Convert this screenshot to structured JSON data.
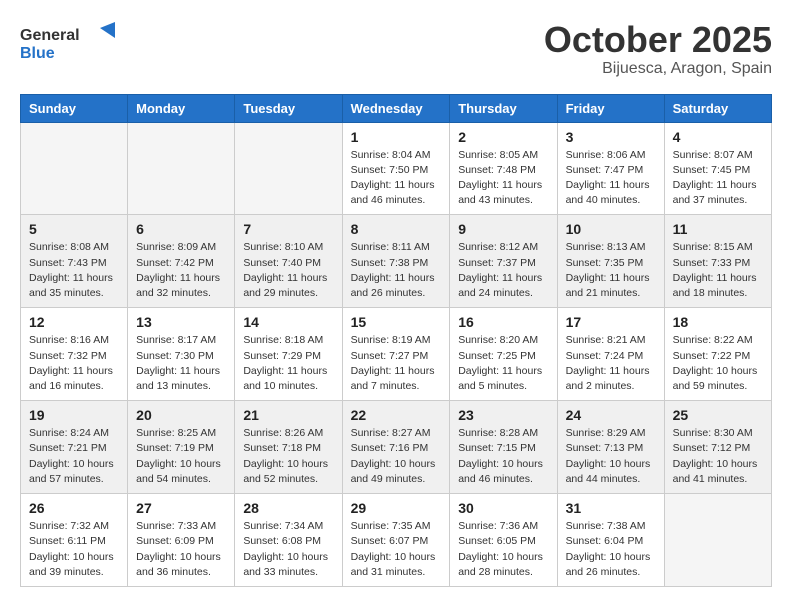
{
  "logo": {
    "general": "General",
    "blue": "Blue"
  },
  "header": {
    "month": "October 2025",
    "location": "Bijuesca, Aragon, Spain"
  },
  "weekdays": [
    "Sunday",
    "Monday",
    "Tuesday",
    "Wednesday",
    "Thursday",
    "Friday",
    "Saturday"
  ],
  "weeks": [
    [
      {
        "day": "",
        "info": ""
      },
      {
        "day": "",
        "info": ""
      },
      {
        "day": "",
        "info": ""
      },
      {
        "day": "1",
        "info": "Sunrise: 8:04 AM\nSunset: 7:50 PM\nDaylight: 11 hours\nand 46 minutes."
      },
      {
        "day": "2",
        "info": "Sunrise: 8:05 AM\nSunset: 7:48 PM\nDaylight: 11 hours\nand 43 minutes."
      },
      {
        "day": "3",
        "info": "Sunrise: 8:06 AM\nSunset: 7:47 PM\nDaylight: 11 hours\nand 40 minutes."
      },
      {
        "day": "4",
        "info": "Sunrise: 8:07 AM\nSunset: 7:45 PM\nDaylight: 11 hours\nand 37 minutes."
      }
    ],
    [
      {
        "day": "5",
        "info": "Sunrise: 8:08 AM\nSunset: 7:43 PM\nDaylight: 11 hours\nand 35 minutes."
      },
      {
        "day": "6",
        "info": "Sunrise: 8:09 AM\nSunset: 7:42 PM\nDaylight: 11 hours\nand 32 minutes."
      },
      {
        "day": "7",
        "info": "Sunrise: 8:10 AM\nSunset: 7:40 PM\nDaylight: 11 hours\nand 29 minutes."
      },
      {
        "day": "8",
        "info": "Sunrise: 8:11 AM\nSunset: 7:38 PM\nDaylight: 11 hours\nand 26 minutes."
      },
      {
        "day": "9",
        "info": "Sunrise: 8:12 AM\nSunset: 7:37 PM\nDaylight: 11 hours\nand 24 minutes."
      },
      {
        "day": "10",
        "info": "Sunrise: 8:13 AM\nSunset: 7:35 PM\nDaylight: 11 hours\nand 21 minutes."
      },
      {
        "day": "11",
        "info": "Sunrise: 8:15 AM\nSunset: 7:33 PM\nDaylight: 11 hours\nand 18 minutes."
      }
    ],
    [
      {
        "day": "12",
        "info": "Sunrise: 8:16 AM\nSunset: 7:32 PM\nDaylight: 11 hours\nand 16 minutes."
      },
      {
        "day": "13",
        "info": "Sunrise: 8:17 AM\nSunset: 7:30 PM\nDaylight: 11 hours\nand 13 minutes."
      },
      {
        "day": "14",
        "info": "Sunrise: 8:18 AM\nSunset: 7:29 PM\nDaylight: 11 hours\nand 10 minutes."
      },
      {
        "day": "15",
        "info": "Sunrise: 8:19 AM\nSunset: 7:27 PM\nDaylight: 11 hours\nand 7 minutes."
      },
      {
        "day": "16",
        "info": "Sunrise: 8:20 AM\nSunset: 7:25 PM\nDaylight: 11 hours\nand 5 minutes."
      },
      {
        "day": "17",
        "info": "Sunrise: 8:21 AM\nSunset: 7:24 PM\nDaylight: 11 hours\nand 2 minutes."
      },
      {
        "day": "18",
        "info": "Sunrise: 8:22 AM\nSunset: 7:22 PM\nDaylight: 10 hours\nand 59 minutes."
      }
    ],
    [
      {
        "day": "19",
        "info": "Sunrise: 8:24 AM\nSunset: 7:21 PM\nDaylight: 10 hours\nand 57 minutes."
      },
      {
        "day": "20",
        "info": "Sunrise: 8:25 AM\nSunset: 7:19 PM\nDaylight: 10 hours\nand 54 minutes."
      },
      {
        "day": "21",
        "info": "Sunrise: 8:26 AM\nSunset: 7:18 PM\nDaylight: 10 hours\nand 52 minutes."
      },
      {
        "day": "22",
        "info": "Sunrise: 8:27 AM\nSunset: 7:16 PM\nDaylight: 10 hours\nand 49 minutes."
      },
      {
        "day": "23",
        "info": "Sunrise: 8:28 AM\nSunset: 7:15 PM\nDaylight: 10 hours\nand 46 minutes."
      },
      {
        "day": "24",
        "info": "Sunrise: 8:29 AM\nSunset: 7:13 PM\nDaylight: 10 hours\nand 44 minutes."
      },
      {
        "day": "25",
        "info": "Sunrise: 8:30 AM\nSunset: 7:12 PM\nDaylight: 10 hours\nand 41 minutes."
      }
    ],
    [
      {
        "day": "26",
        "info": "Sunrise: 7:32 AM\nSunset: 6:11 PM\nDaylight: 10 hours\nand 39 minutes."
      },
      {
        "day": "27",
        "info": "Sunrise: 7:33 AM\nSunset: 6:09 PM\nDaylight: 10 hours\nand 36 minutes."
      },
      {
        "day": "28",
        "info": "Sunrise: 7:34 AM\nSunset: 6:08 PM\nDaylight: 10 hours\nand 33 minutes."
      },
      {
        "day": "29",
        "info": "Sunrise: 7:35 AM\nSunset: 6:07 PM\nDaylight: 10 hours\nand 31 minutes."
      },
      {
        "day": "30",
        "info": "Sunrise: 7:36 AM\nSunset: 6:05 PM\nDaylight: 10 hours\nand 28 minutes."
      },
      {
        "day": "31",
        "info": "Sunrise: 7:38 AM\nSunset: 6:04 PM\nDaylight: 10 hours\nand 26 minutes."
      },
      {
        "day": "",
        "info": ""
      }
    ]
  ]
}
